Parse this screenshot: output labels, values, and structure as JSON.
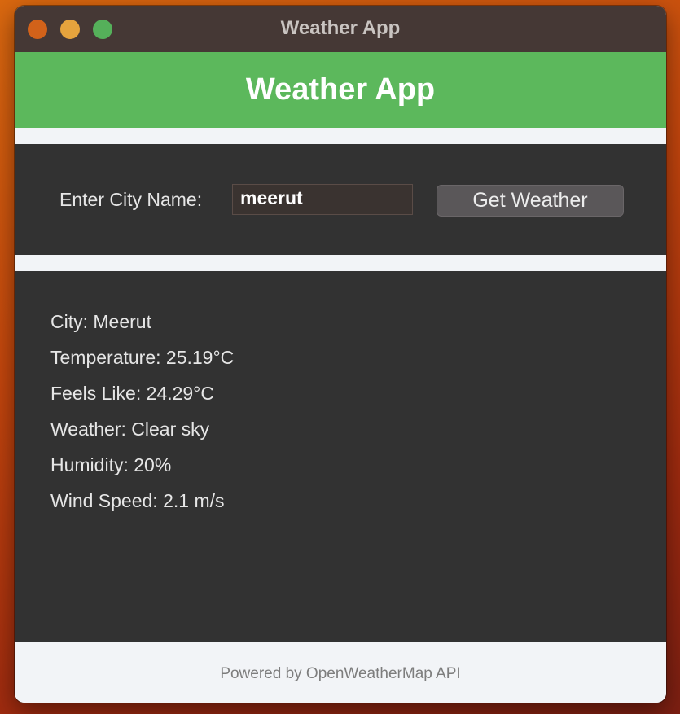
{
  "window": {
    "title": "Weather App"
  },
  "header": {
    "title": "Weather App"
  },
  "search": {
    "label": "Enter City Name:",
    "value": "meerut",
    "button_label": "Get Weather"
  },
  "results": {
    "city": "City: Meerut",
    "temperature": "Temperature: 25.19°C",
    "feels_like": "Feels Like: 24.29°C",
    "weather": "Weather: Clear sky",
    "humidity": "Humidity: 20%",
    "wind_speed": "Wind Speed: 2.1 m/s"
  },
  "footer": {
    "text": "Powered by OpenWeatherMap API"
  },
  "colors": {
    "header_green": "#5cb85c",
    "panel_dark": "#323232",
    "titlebar": "#453835",
    "button": "#5a5759",
    "footer_bg": "#f2f4f7"
  },
  "icons": {
    "close": "close-icon",
    "minimize": "minimize-icon",
    "maximize": "maximize-icon"
  }
}
